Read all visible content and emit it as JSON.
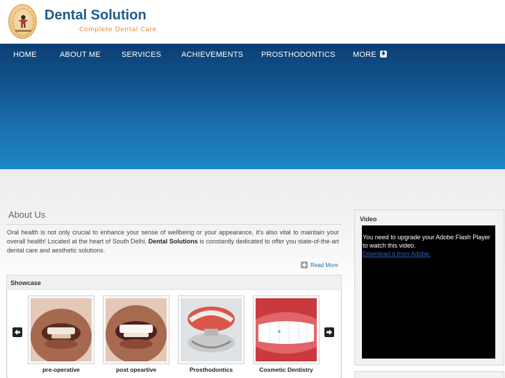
{
  "brand": {
    "title": "Dental Solution",
    "tagline": "Complete Dental Care"
  },
  "nav": {
    "items": [
      {
        "label": "HOME"
      },
      {
        "label": "ABOUT ME"
      },
      {
        "label": "SERVICES"
      },
      {
        "label": "ACHIEVEMENTS"
      },
      {
        "label": "PROSTHODONTICS"
      },
      {
        "label": "MORE"
      }
    ]
  },
  "about": {
    "title": "About Us",
    "text_before": "Oral health is not only crucial to enhance your sense of wellbeing or your appearance, it's also vital to maintain your overall health! Located at the heart of South Delhi,",
    "text_bold": "Dental Solutions",
    "text_after": "is constantly dedicated to offer you state-of-the-art dental care and aesthetic solutions.",
    "read_more": "Read More"
  },
  "showcase": {
    "title": "Showcase",
    "items": [
      {
        "caption": "pre-operative"
      },
      {
        "caption": "post opeartive"
      },
      {
        "caption": "Prosthodontics"
      },
      {
        "caption": "Cosmetic Dentistry"
      }
    ]
  },
  "video": {
    "title": "Video",
    "message": "You need to upgrade your Adobe Flash Player to watch this video.",
    "link": "Download it from Adobe."
  },
  "colors": {
    "brand_blue": "#1e5a8c",
    "tagline_orange": "#e08a2c",
    "nav_dark": "#0c3f74",
    "hero_light": "#1f86c6"
  }
}
